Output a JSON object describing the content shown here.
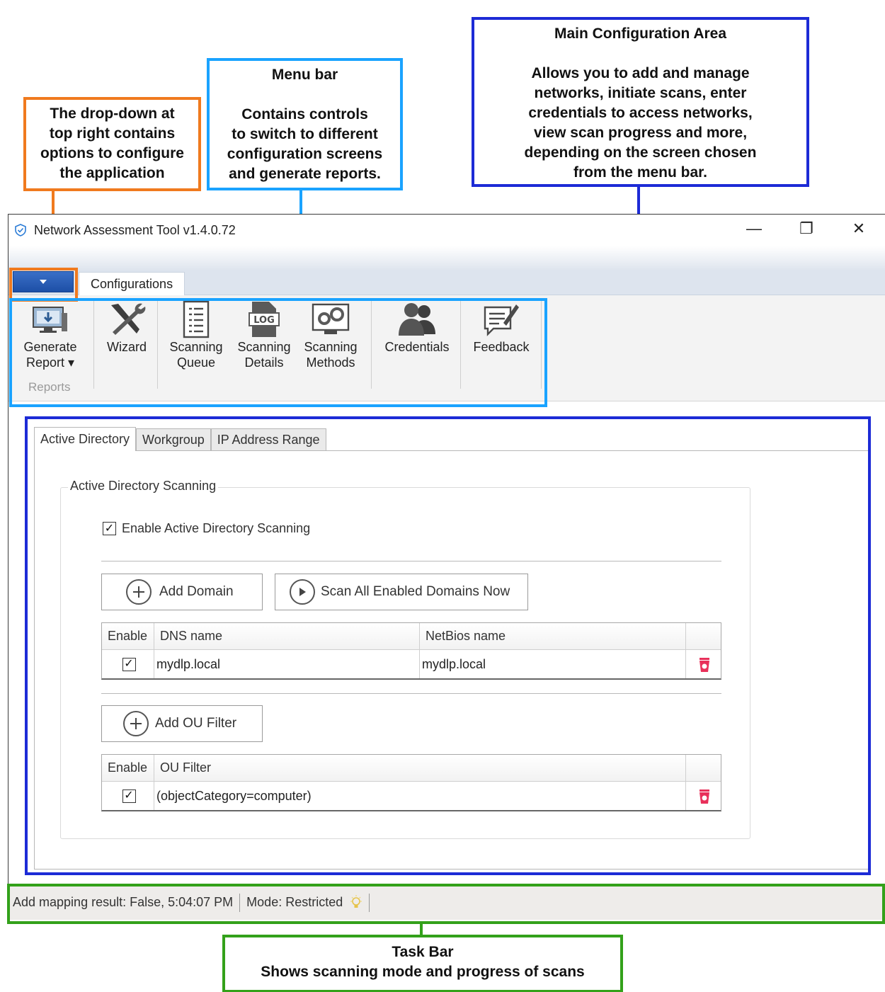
{
  "callouts": {
    "config_dropdown": "The drop-down at\ntop right contains\noptions to configure\nthe application",
    "menu_bar_title": "Menu bar",
    "menu_bar_body": "Contains controls\nto switch to different\nconfiguration screens\nand generate reports.",
    "main_area_title": "Main Configuration Area",
    "main_area_body": "Allows you to add and manage\nnetworks, initiate scans, enter\ncredentials to access networks,\nview scan progress and more,\ndepending on the screen chosen\nfrom the menu bar.",
    "task_bar_title": "Task Bar",
    "task_bar_body": "Shows scanning mode and progress of scans"
  },
  "window": {
    "title": "Network Assessment Tool v1.4.0.72",
    "minimize": "—",
    "restore": "❐",
    "close": "✕"
  },
  "ribbon": {
    "tab": "Configurations",
    "buttons": [
      {
        "label": "Generate\nReport ▾",
        "icon": "generate-report-icon"
      },
      {
        "label": "Wizard",
        "icon": "wizard-tools-icon"
      },
      {
        "label": "Scanning\nQueue",
        "icon": "scanning-queue-icon"
      },
      {
        "label": "Scanning\nDetails",
        "icon": "log-file-icon"
      },
      {
        "label": "Scanning\nMethods",
        "icon": "scanning-methods-icon"
      },
      {
        "label": "Credentials",
        "icon": "users-icon"
      },
      {
        "label": "Feedback",
        "icon": "feedback-icon"
      }
    ],
    "group_label": "Reports"
  },
  "tabs": [
    "Active Directory",
    "Workgroup",
    "IP Address Range"
  ],
  "ad": {
    "group_title": "Active Directory Scanning",
    "enable_label": "Enable Active Directory Scanning",
    "enable_checked": true,
    "add_domain": "Add Domain",
    "scan_all": "Scan All Enabled Domains Now",
    "domains_headers": [
      "Enable",
      "DNS name",
      "NetBios name",
      ""
    ],
    "domains_rows": [
      {
        "enabled": true,
        "dns": "mydlp.local",
        "netbios": "mydlp.local"
      }
    ],
    "add_ou": "Add OU Filter",
    "ou_headers": [
      "Enable",
      "OU Filter",
      ""
    ],
    "ou_rows": [
      {
        "enabled": true,
        "filter": "(objectCategory=computer)"
      }
    ]
  },
  "status": {
    "message": "Add mapping result: False, 5:04:07 PM",
    "mode": "Mode: Restricted"
  },
  "colors": {
    "orange": "#f07a1e",
    "light_blue": "#1aa3ff",
    "dark_blue": "#1d2bd6",
    "green": "#33a11a",
    "delete_red": "#e8305a"
  }
}
